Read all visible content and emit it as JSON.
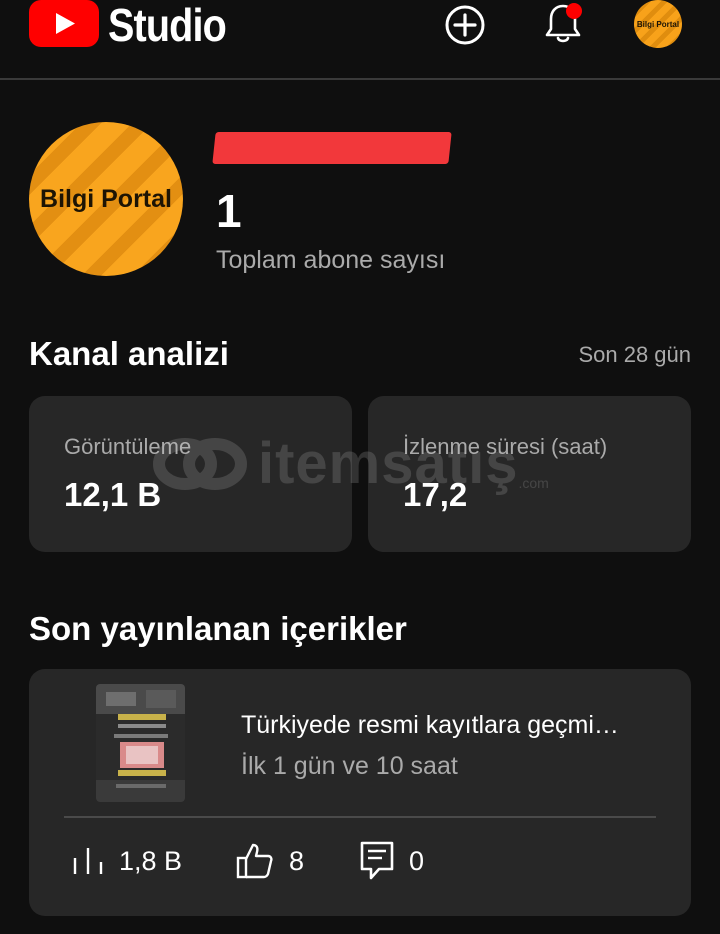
{
  "header": {
    "app_name": "Studio",
    "icons": [
      "youtube-logo",
      "create-icon",
      "bell-icon",
      "account-avatar"
    ],
    "notification_dot_color": "#ff0000",
    "account_avatar_text": "Bilgi Portal"
  },
  "channel": {
    "avatar_text": "Bilgi Portal",
    "name": "",
    "name_redacted": true,
    "subscriber_count": "1",
    "subscriber_label": "Toplam abone sayısı"
  },
  "analytics": {
    "title": "Kanal analizi",
    "period": "Son 28 gün",
    "cards": [
      {
        "label": "Görüntüleme",
        "value": "12,1 B"
      },
      {
        "label": "İzlenme süresi (saat)",
        "value": "17,2"
      }
    ]
  },
  "watermark": {
    "text": "itemsatış",
    "suffix": ".com"
  },
  "recent": {
    "title": "Son yayınlanan içerikler",
    "items": [
      {
        "title": "Türkiyede resmi kayıtlara geçmi…",
        "age": "İlk 1 gün ve 10 saat",
        "views": "1,8 B",
        "likes": "8",
        "comments": "0"
      }
    ]
  },
  "colors": {
    "background": "#0f0f0f",
    "card": "#272727",
    "accent_red": "#ff0000",
    "avatar_orange": "#f9a51e",
    "secondary_text": "#aaaaaa"
  }
}
